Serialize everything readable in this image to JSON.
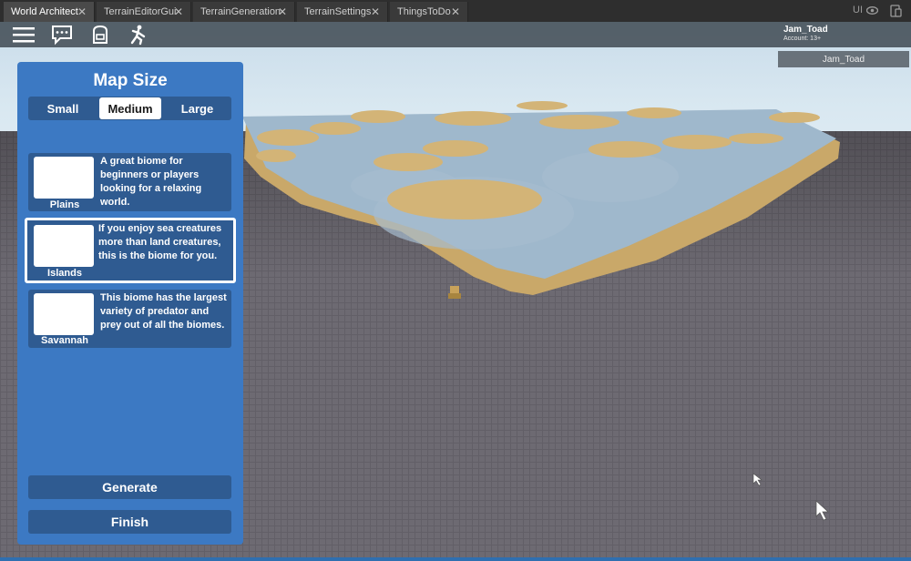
{
  "studio_tabs": [
    {
      "label": "World Architect",
      "active": true
    },
    {
      "label": "TerrainEditorGui",
      "active": false
    },
    {
      "label": "TerrainGeneration",
      "active": false
    },
    {
      "label": "TerrainSettings",
      "active": false
    },
    {
      "label": "ThingsToDo",
      "active": false
    }
  ],
  "tab_close_glyph": "✕",
  "ui_toggle_label": "UI",
  "account": {
    "name": "Jam_Toad",
    "subtitle": "Account: 13+"
  },
  "player_list": [
    "Jam_Toad"
  ],
  "panel": {
    "title": "Map Size",
    "sizes": [
      {
        "label": "Small",
        "selected": false
      },
      {
        "label": "Medium",
        "selected": true
      },
      {
        "label": "Large",
        "selected": false
      }
    ],
    "biomes": [
      {
        "name": "Plains",
        "description": "A great biome for beginners or players looking for a relaxing world.",
        "selected": false
      },
      {
        "name": "Islands",
        "description": "If you enjoy sea creatures more than land creatures, this is the biome for you.",
        "selected": true
      },
      {
        "name": "Savannah",
        "description": "This biome has the largest variety of predator and prey out of all the biomes.",
        "selected": false
      }
    ],
    "generate_label": "Generate",
    "finish_label": "Finish"
  },
  "colors": {
    "panel": "#3c79c3",
    "panel_dark": "#2f5b91",
    "sky": "#d9e8f1",
    "baseplate": "#6d6a72",
    "water": "#93aec6",
    "sand": "#d3b477"
  },
  "icons": [
    "menu-icon",
    "chat-icon",
    "backpack-icon",
    "emote-icon",
    "eye-icon",
    "device-icon"
  ]
}
